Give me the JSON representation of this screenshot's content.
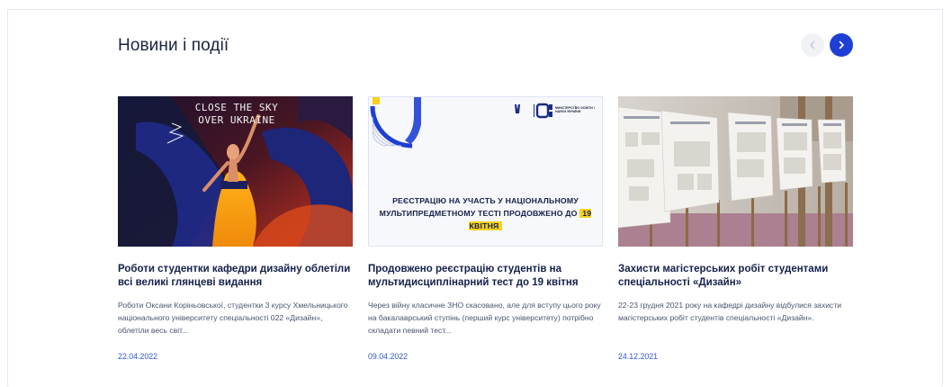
{
  "section": {
    "title": "Новини і події",
    "nav": {
      "prev_icon": "chevron-left-icon",
      "next_icon": "chevron-right-icon",
      "accent": "#1e3fd6"
    }
  },
  "cards": [
    {
      "image_text": "CLOSE THE SKY OVER UKRAINE",
      "title": "Роботи студентки кафедри дизайну облетіли всі великі глянцеві видання",
      "excerpt": "Роботи Оксани Коріньовської, студентки 3 курсу Хмельницького національного університету спеціальності 022 «Дизайн», облетіли весь світ...",
      "date": "22.04.2022"
    },
    {
      "image_text_main": "РЕЄСТРАЦІЮ НА УЧАСТЬ У НАЦІОНАЛЬНОМУ МУЛЬТИПРЕДМЕТНОМУ ТЕСТІ ПРОДОВЖЕНО ДО",
      "image_text_highlight": "19 КВІТНЯ",
      "image_logo_text": "МІНІСТЕРСТВО ОСВІТИ І НАУКИ УКРАЇНИ",
      "title": "Продовжено реєстрацію студентів на мультидисциплінарний тест до 19 квітня",
      "excerpt": "Через війну класичне ЗНО скасовано, але для вступу цього року на бакалаврський ступінь (перший курс університету) потрібно складати певний тест...",
      "date": "09.04.2022"
    },
    {
      "title": "Захисти магістерських робіт студентами спеціальності «Дизайн»",
      "excerpt": "22-23 грудня 2021 року на кафедрі дизайну відбулися захисти магістерських робіт студентів спеціальності «Дизайн».",
      "date": "24.12.2021"
    }
  ]
}
